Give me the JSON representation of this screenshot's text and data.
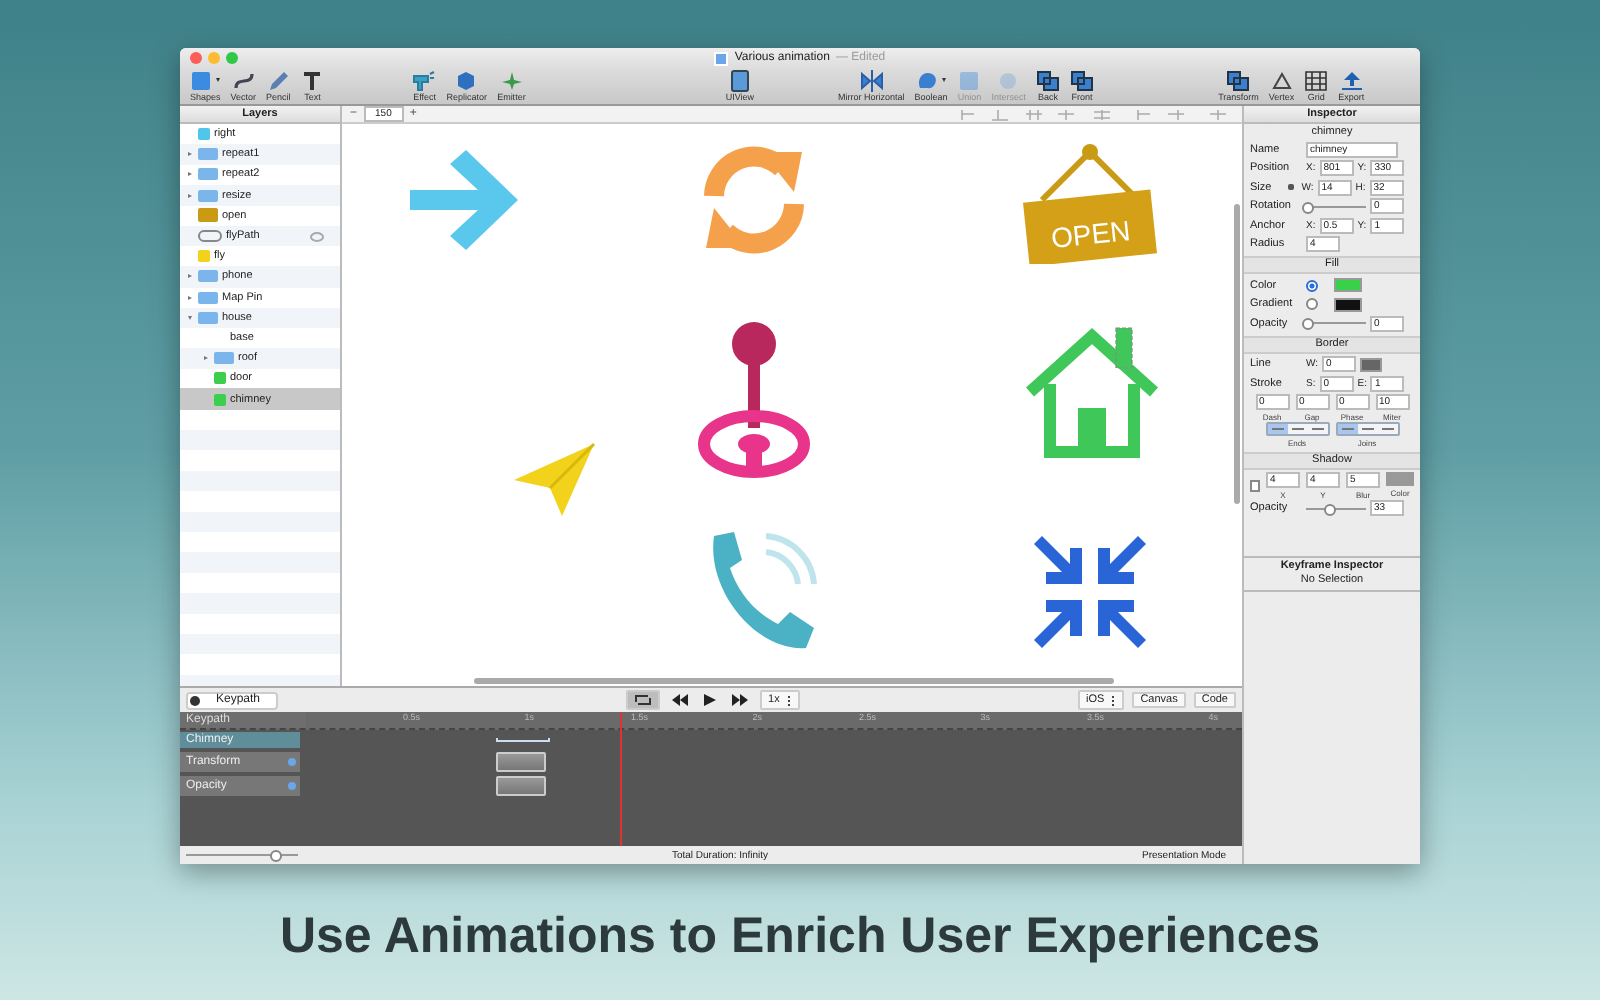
{
  "window": {
    "title": "Various animation",
    "edited": "— Edited"
  },
  "toolbar": {
    "groups": [
      [
        {
          "label": "Shapes",
          "menu": true,
          "disabled": false
        },
        {
          "label": "Vector",
          "menu": false,
          "disabled": false
        },
        {
          "label": "Pencil",
          "menu": false,
          "disabled": false
        },
        {
          "label": "Text",
          "menu": false,
          "disabled": false
        }
      ],
      [
        {
          "label": "Effect",
          "menu": false,
          "disabled": false
        },
        {
          "label": "Replicator",
          "menu": false,
          "disabled": false
        },
        {
          "label": "Emitter",
          "menu": false,
          "disabled": false
        }
      ],
      [
        {
          "label": "UIView",
          "menu": false,
          "disabled": false
        }
      ],
      [
        {
          "label": "Mirror Horizontal",
          "menu": false,
          "disabled": false
        },
        {
          "label": "Boolean",
          "menu": true,
          "disabled": false
        },
        {
          "label": "Union",
          "menu": false,
          "disabled": true
        },
        {
          "label": "Intersect",
          "menu": false,
          "disabled": true
        },
        {
          "label": "Back",
          "menu": false,
          "disabled": false
        },
        {
          "label": "Front",
          "menu": false,
          "disabled": false
        }
      ],
      [
        {
          "label": "Transform",
          "menu": false,
          "disabled": false
        },
        {
          "label": "Vertex",
          "menu": false,
          "disabled": false
        },
        {
          "label": "Grid",
          "menu": false,
          "disabled": false
        },
        {
          "label": "Export",
          "menu": false,
          "disabled": false
        }
      ]
    ]
  },
  "layers": {
    "title": "Layers",
    "items": [
      {
        "name": "right",
        "kind": "shape",
        "color": "#4fc6ea",
        "selected": false,
        "eye": false
      },
      {
        "name": "repeat1",
        "kind": "group",
        "expanded": false,
        "selected": false,
        "eye": false
      },
      {
        "name": "repeat2",
        "kind": "group",
        "expanded": false,
        "selected": false,
        "eye": false
      },
      {
        "name": "resize",
        "kind": "group",
        "expanded": false,
        "selected": false,
        "eye": false
      },
      {
        "name": "open",
        "kind": "image",
        "selected": false,
        "eye": false
      },
      {
        "name": "flyPath",
        "kind": "path",
        "selected": false,
        "eye": true
      },
      {
        "name": "fly",
        "kind": "shape",
        "color": "#f2d21b",
        "selected": false,
        "eye": false
      },
      {
        "name": "phone",
        "kind": "group",
        "expanded": false,
        "selected": false,
        "eye": false
      },
      {
        "name": "Map Pin",
        "kind": "group",
        "expanded": false,
        "selected": false,
        "eye": false
      },
      {
        "name": "house",
        "kind": "group",
        "expanded": true,
        "selected": false,
        "eye": false,
        "children": [
          {
            "name": "base",
            "kind": "plain",
            "selected": false,
            "eye": false
          },
          {
            "name": "roof",
            "kind": "group",
            "expanded": false,
            "selected": false,
            "eye": false
          },
          {
            "name": "door",
            "kind": "shape",
            "color": "#3ccf4e",
            "selected": false,
            "eye": false
          },
          {
            "name": "chimney",
            "kind": "shape",
            "color": "#3ccf4e",
            "selected": true,
            "eye": false
          }
        ]
      }
    ]
  },
  "canvas": {
    "zoom_out": "−",
    "zoom": "150",
    "zoom_in": "+",
    "sign_text": "OPEN"
  },
  "inspector": {
    "title": "Inspector",
    "subtitle": "chimney",
    "rows": [
      {
        "kind": "fields",
        "label": "Name",
        "fields": [
          {
            "value": "chimney"
          }
        ]
      },
      {
        "kind": "fields",
        "label": "Position",
        "fields": [
          {
            "prefix": "X:",
            "value": "801"
          },
          {
            "prefix": "Y:",
            "value": "330"
          }
        ]
      },
      {
        "kind": "fields",
        "label": "Size",
        "locked": true,
        "fields": [
          {
            "prefix": "W:",
            "value": "14"
          },
          {
            "prefix": "H:",
            "value": "32"
          }
        ]
      },
      {
        "kind": "slider",
        "label": "Rotation",
        "level": 0,
        "value": "0"
      },
      {
        "kind": "fields",
        "label": "Anchor",
        "fields": [
          {
            "prefix": "X:",
            "value": "0.5"
          },
          {
            "prefix": "Y:",
            "value": "1"
          }
        ]
      },
      {
        "kind": "fields",
        "label": "Radius",
        "fields": [
          {
            "value": "4"
          }
        ]
      },
      {
        "kind": "section",
        "label": "Fill"
      },
      {
        "kind": "radio",
        "label": "Color",
        "selected": true,
        "color": "#3ad14a"
      },
      {
        "kind": "radio",
        "label": "Gradient",
        "selected": false,
        "color": "#111111"
      },
      {
        "kind": "slider",
        "label": "Opacity",
        "level": 0,
        "value": "0"
      },
      {
        "kind": "section",
        "label": "Border"
      },
      {
        "kind": "fields",
        "label": "Line",
        "fields": [
          {
            "prefix": "W:",
            "value": "0"
          }
        ],
        "color": "#666666"
      },
      {
        "kind": "fields",
        "label": "Stroke",
        "fields": [
          {
            "prefix": "S:",
            "value": "0"
          },
          {
            "prefix": "E:",
            "value": "1"
          }
        ]
      },
      {
        "kind": "quad",
        "fields": [
          {
            "value": "0",
            "caption": "Dash"
          },
          {
            "value": "0",
            "caption": "Gap"
          },
          {
            "value": "0",
            "caption": "Phase"
          },
          {
            "value": "10",
            "caption": "Miter"
          }
        ]
      },
      {
        "kind": "segments",
        "groups": [
          {
            "caption": "Ends",
            "options": [
              {
                "selected": true
              },
              {
                "selected": false
              },
              {
                "selected": false
              }
            ]
          },
          {
            "caption": "Joins",
            "options": [
              {
                "selected": true
              },
              {
                "selected": false
              },
              {
                "selected": false
              }
            ]
          }
        ]
      },
      {
        "kind": "section",
        "label": "Shadow"
      },
      {
        "kind": "shadow",
        "checked": false,
        "fields": [
          {
            "value": "4",
            "caption": "X"
          },
          {
            "value": "4",
            "caption": "Y"
          },
          {
            "value": "5",
            "caption": "Blur"
          }
        ],
        "color": "#999999",
        "color_caption": "Color"
      },
      {
        "kind": "slider",
        "label": "Opacity",
        "level": 0.35,
        "value": "33"
      }
    ]
  },
  "keyframe_inspector": {
    "title": "Keyframe Inspector",
    "status": "No Selection"
  },
  "timeline": {
    "keypath_field": "Keypath",
    "loop": true,
    "speed": "1x",
    "platform": "iOS",
    "canvas_button": "Canvas",
    "code_button": "Code",
    "header": "Keypath",
    "ticks": [
      "0.5s",
      "1s",
      "1.5s",
      "2s",
      "2.5s",
      "3s",
      "3.5s",
      "4s"
    ],
    "tracks": [
      {
        "label": "Chimney",
        "kind": "layer",
        "selected": true
      },
      {
        "label": "Transform",
        "kind": "property",
        "selected": false
      },
      {
        "label": "Opacity",
        "kind": "property",
        "selected": false
      }
    ],
    "zoom_slider": {
      "level": 0.8
    },
    "total_duration": "Total Duration: Infinity",
    "mode": "Presentation Mode"
  },
  "caption": "Use Animations to Enrich User Experiences"
}
